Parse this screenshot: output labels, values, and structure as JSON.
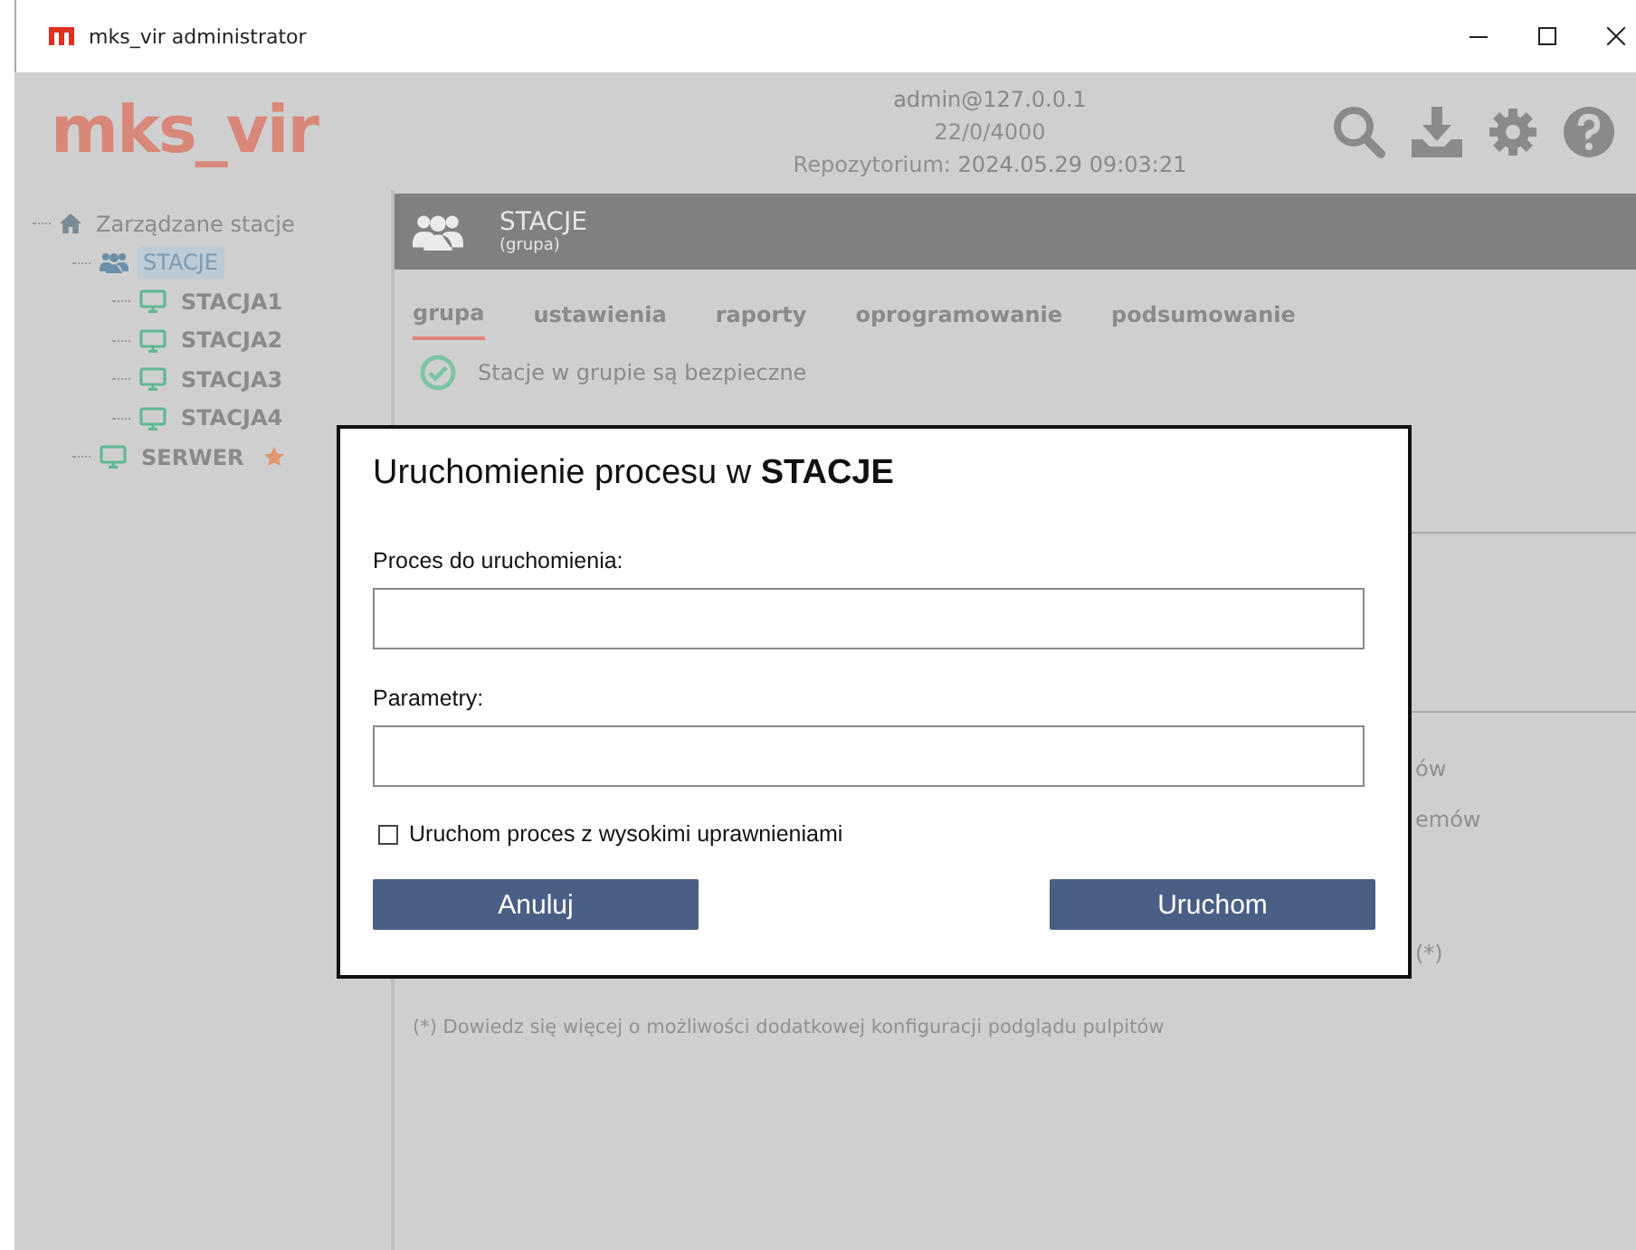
{
  "window": {
    "title": "mks_vir administrator"
  },
  "header": {
    "logo": "mks_vir",
    "user": "admin@127.0.0.1",
    "counts": "22/0/4000",
    "repo_label": "Repozytorium:",
    "repo_date": "2024.05.29 09:03:21"
  },
  "tree": [
    {
      "label": "Zarządzane stacje",
      "kind": "home",
      "selected": false,
      "children": [
        {
          "label": "STACJE",
          "kind": "group",
          "selected": true,
          "children": [
            {
              "label": "STACJA1",
              "kind": "station",
              "selected": false
            },
            {
              "label": "STACJA2",
              "kind": "station",
              "selected": false
            },
            {
              "label": "STACJA3",
              "kind": "station",
              "selected": false
            },
            {
              "label": "STACJA4",
              "kind": "station",
              "selected": false
            }
          ]
        },
        {
          "label": "SERWER",
          "kind": "station",
          "selected": false,
          "starred": true
        }
      ]
    }
  ],
  "panel": {
    "title": "STACJE",
    "subtitle": "(grupa)",
    "tabs": [
      {
        "label": "grupa",
        "selected": true
      },
      {
        "label": "ustawienia",
        "selected": false
      },
      {
        "label": "raporty",
        "selected": false
      },
      {
        "label": "oprogramowanie",
        "selected": false
      },
      {
        "label": "podsumowanie",
        "selected": false
      }
    ],
    "status": "Stacje w grupie są bezpieczne",
    "hidden_texts": [
      "ów",
      "emów",
      "(*)"
    ],
    "footnote": "(*) Dowiedz się więcej o możliwości dodatkowej konfiguracji podglądu pulpitów"
  },
  "dialog": {
    "title": "Uruchomienie procesu w **STACJE**",
    "fields": [
      {
        "label": "Proces do uruchomienia:"
      },
      {
        "label": "Parametry:"
      }
    ],
    "checkbox": {
      "label": "Uruchom proces z wysokimi uprawnieniami",
      "checked": false
    },
    "buttons": [
      "Anuluj",
      "Uruchom"
    ]
  }
}
